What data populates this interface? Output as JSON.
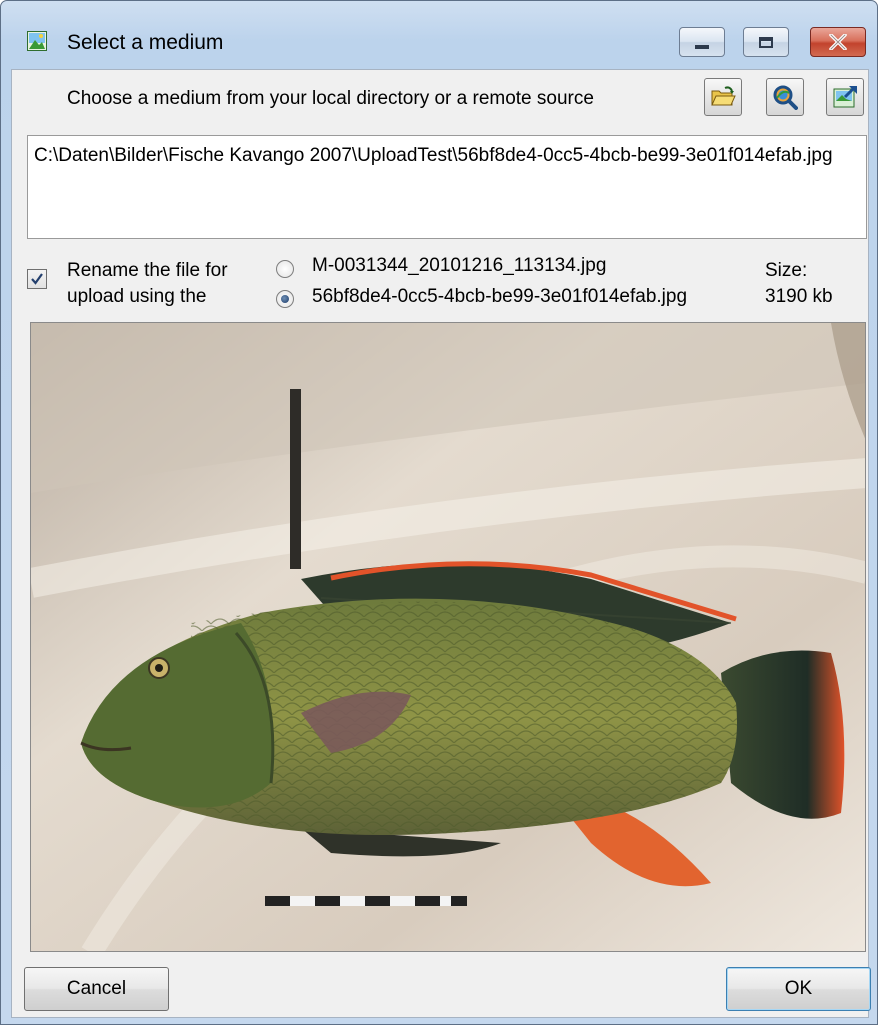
{
  "window": {
    "title": "Select a medium"
  },
  "header": {
    "instruction": "Choose a medium from your local directory or a remote source",
    "tools": [
      "open-folder-icon",
      "search-remote-icon",
      "export-icon"
    ]
  },
  "path": {
    "value": "C:\\Daten\\Bilder\\Fische Kavango 2007\\UploadTest\\56bf8de4-0cc5-4bcb-be99-3e01f014efab.jpg"
  },
  "rename": {
    "checked": true,
    "label": "Rename the file for upload using the",
    "options": [
      {
        "label": "M-0031344_20101216_113134.jpg",
        "selected": false
      },
      {
        "label": "56bf8de4-0cc5-4bcb-be99-3e01f014efab.jpg",
        "selected": true
      }
    ]
  },
  "size": {
    "label": "Size:",
    "value": "3190 kb"
  },
  "buttons": {
    "cancel": "Cancel",
    "ok": "OK"
  },
  "colors": {
    "titlebar": "#bcd3ec",
    "client_bg": "#f0f0f0",
    "close_button": "#c2432d"
  }
}
